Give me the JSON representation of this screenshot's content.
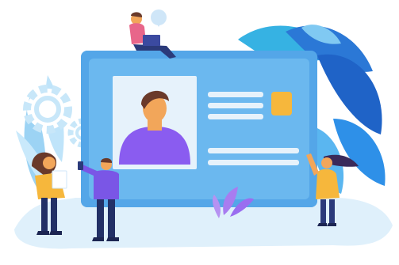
{
  "illustration": {
    "subject": "id-card-with-people",
    "colors": {
      "card_blue": "#4e9ee6",
      "card_panel": "#e6f2fb",
      "accent_yellow": "#f6b73c",
      "leaf_dark": "#2b78d6",
      "leaf_light": "#80c9f2",
      "avatar_purple": "#8a5cf0",
      "skin": "#f2a65a",
      "hair": "#6a3a2a"
    }
  }
}
